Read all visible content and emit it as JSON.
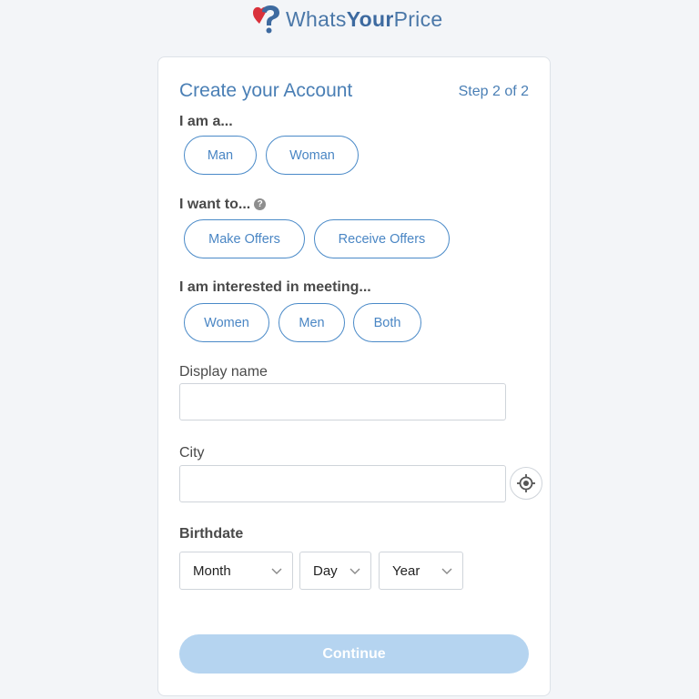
{
  "brand": {
    "name_prefix": "Whats",
    "name_bold": "Your",
    "name_suffix": "Price",
    "colors": {
      "heart": "#d9313b",
      "question": "#3d6aa0",
      "text": "#4a77a8"
    },
    "logo_icon": "heart-question-mark-logo"
  },
  "form": {
    "title": "Create your Account",
    "step": "Step 2 of 2",
    "gender": {
      "label": "I am a...",
      "options": [
        "Man",
        "Woman"
      ]
    },
    "intent": {
      "label": "I want to...",
      "help_icon": "question-circle-icon",
      "options": [
        "Make Offers",
        "Receive Offers"
      ]
    },
    "interest": {
      "label": "I am interested in meeting...",
      "options": [
        "Women",
        "Men",
        "Both"
      ]
    },
    "display_name": {
      "label": "Display name",
      "value": "",
      "placeholder": ""
    },
    "city": {
      "label": "City",
      "value": "",
      "placeholder": "",
      "locate_icon": "crosshair-location-icon"
    },
    "birthdate": {
      "label": "Birthdate",
      "month": "Month",
      "day": "Day",
      "year": "Year"
    },
    "continue_label": "Continue"
  },
  "colors": {
    "accent": "#4a86c4",
    "continue_disabled": "#b5d4f0",
    "background": "#f3f5f8"
  }
}
